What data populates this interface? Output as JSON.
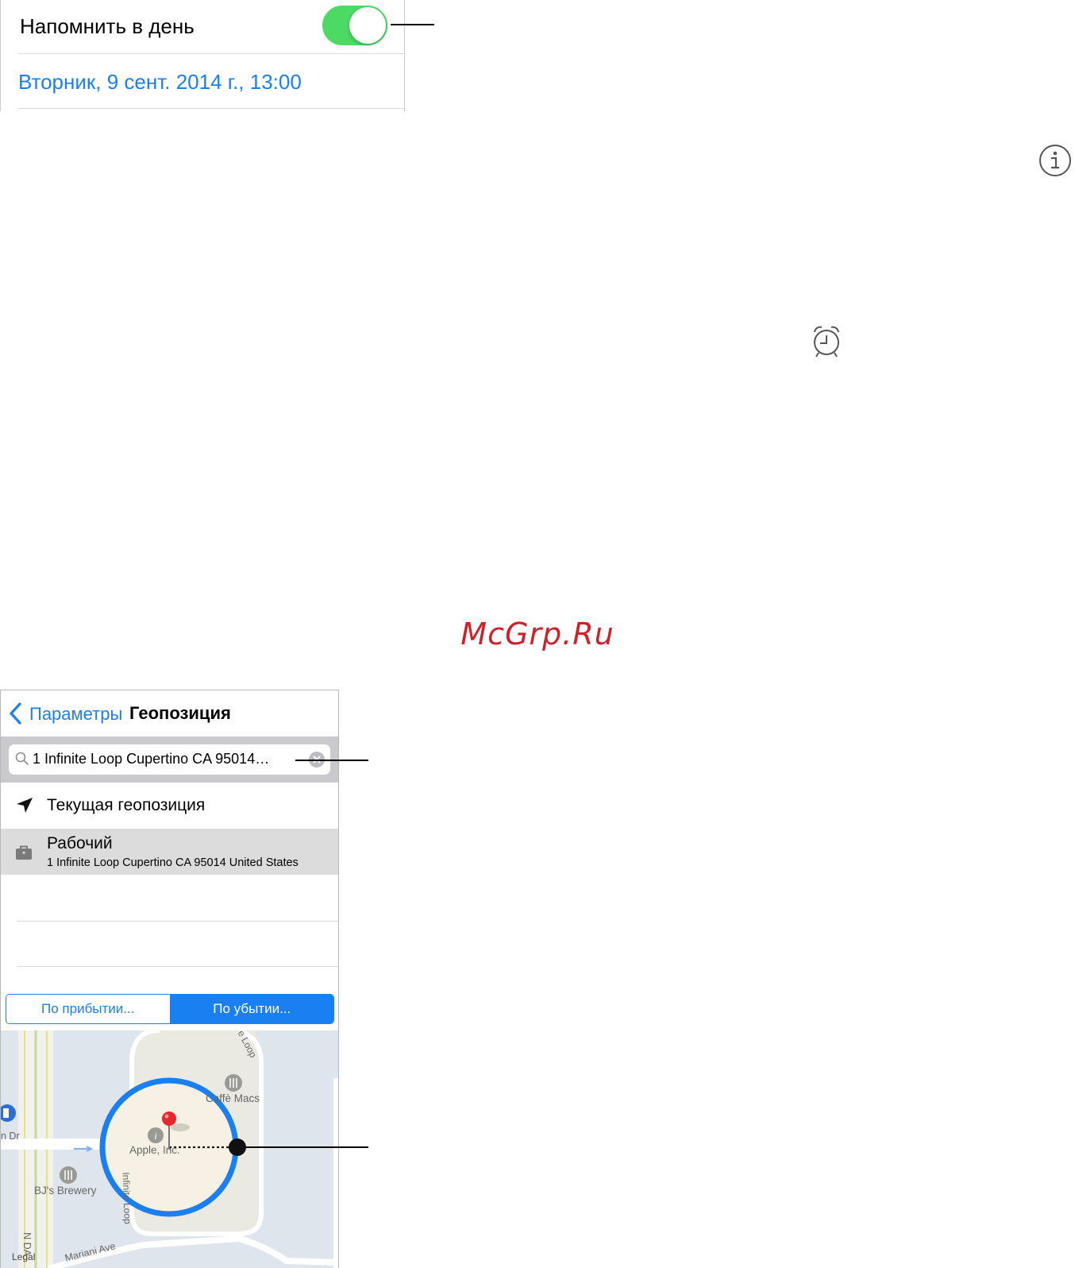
{
  "reminder": {
    "remind_on_day_label": "Напомнить в день",
    "remind_on_day_enabled": true,
    "date_value": "Вторник, 9 сент. 2014 г., 13:00"
  },
  "icons": {
    "info": "info-icon",
    "alarm": "alarm-clock-icon",
    "back": "chevron-left-icon",
    "search": "search-icon",
    "clear": "clear-icon",
    "location_arrow": "location-arrow-icon",
    "briefcase": "briefcase-icon",
    "pin": "map-pin-icon"
  },
  "watermark": "McGrp.Ru",
  "location_screen": {
    "back_label": "Параметры",
    "title": "Геопозиция",
    "search_value": "1 Infinite Loop Cupertino CA 95014…",
    "current_location_label": "Текущая геопозиция",
    "work": {
      "title": "Рабочий",
      "address": "1 Infinite Loop Cupertino CA 95014 United States"
    },
    "segment": {
      "arrive_label": "По прибытии...",
      "leave_label": "По убытии...",
      "selected": "leave"
    },
    "map": {
      "labels": {
        "cafe": "Caffè Macs",
        "apple": "Apple, Inc.",
        "brewery": "BJ's Brewery",
        "infinite_loop": "Infinite Loop",
        "loop_top": "e Loop",
        "mariani": "Mariani Ave",
        "n_de_anza": "N DA",
        "dr": "n Dr",
        "legal": "Legal"
      }
    }
  },
  "colors": {
    "accent_blue": "#1a7ff0",
    "toggle_green": "#4cd964",
    "watermark_red": "#d0202a",
    "geofence_blue": "#1a7ff0",
    "pin_red": "#e8262d"
  }
}
